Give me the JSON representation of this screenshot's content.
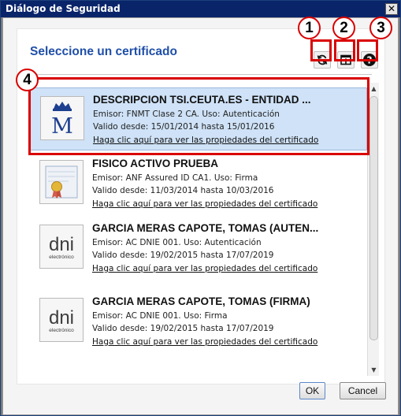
{
  "window": {
    "title": "Diálogo de Seguridad",
    "close_glyph": "✕"
  },
  "header": {
    "title": "Seleccione un certificado"
  },
  "toolbar": {
    "refresh_icon": "refresh-icon",
    "open_icon": "open-window-icon",
    "help_icon": "help-icon"
  },
  "certificates": [
    {
      "name": "DESCRIPCION TSI.CEUTA.ES - ENTIDAD ...",
      "issuer_line": "Emisor: FNMT Clase 2 CA. Uso: Autenticación",
      "validity_line": "Valido desde: 15/01/2014 hasta 15/01/2016",
      "link": "Haga clic aquí para ver las propiedades del certificado",
      "icon": "crown-m-icon",
      "selected": true
    },
    {
      "name": "FISICO ACTIVO PRUEBA",
      "issuer_line": "Emisor: ANF Assured ID CA1. Uso: Firma",
      "validity_line": "Valido desde: 11/03/2014 hasta 10/03/2016",
      "link": "Haga clic aquí para ver las propiedades del certificado",
      "icon": "certificate-seal-icon",
      "selected": false
    },
    {
      "name": "GARCIA MERAS CAPOTE, TOMAS (AUTEN...",
      "issuer_line": "Emisor: AC DNIE 001. Uso: Autenticación",
      "validity_line": "Valido desde: 19/02/2015 hasta 17/07/2019",
      "link": "Haga clic aquí para ver las propiedades del certificado",
      "icon": "dni-icon",
      "icon_text": "dni",
      "icon_subtext": "electrónico",
      "selected": false
    },
    {
      "name": "GARCIA MERAS CAPOTE, TOMAS (FIRMA)",
      "issuer_line": "Emisor: AC DNIE 001. Uso: Firma",
      "validity_line": "Valido desde: 19/02/2015 hasta 17/07/2019",
      "link": "Haga clic aquí para ver las propiedades del certificado",
      "icon": "dni-icon",
      "icon_text": "dni",
      "icon_subtext": "electrónico",
      "selected": false
    }
  ],
  "buttons": {
    "ok": "OK",
    "cancel": "Cancel"
  },
  "annotations": [
    "1",
    "2",
    "3",
    "4"
  ],
  "colors": {
    "title_bar": "#0a246a",
    "heading": "#1f4fa8",
    "selection": "#cfe2f7",
    "annotation": "#d90000"
  }
}
